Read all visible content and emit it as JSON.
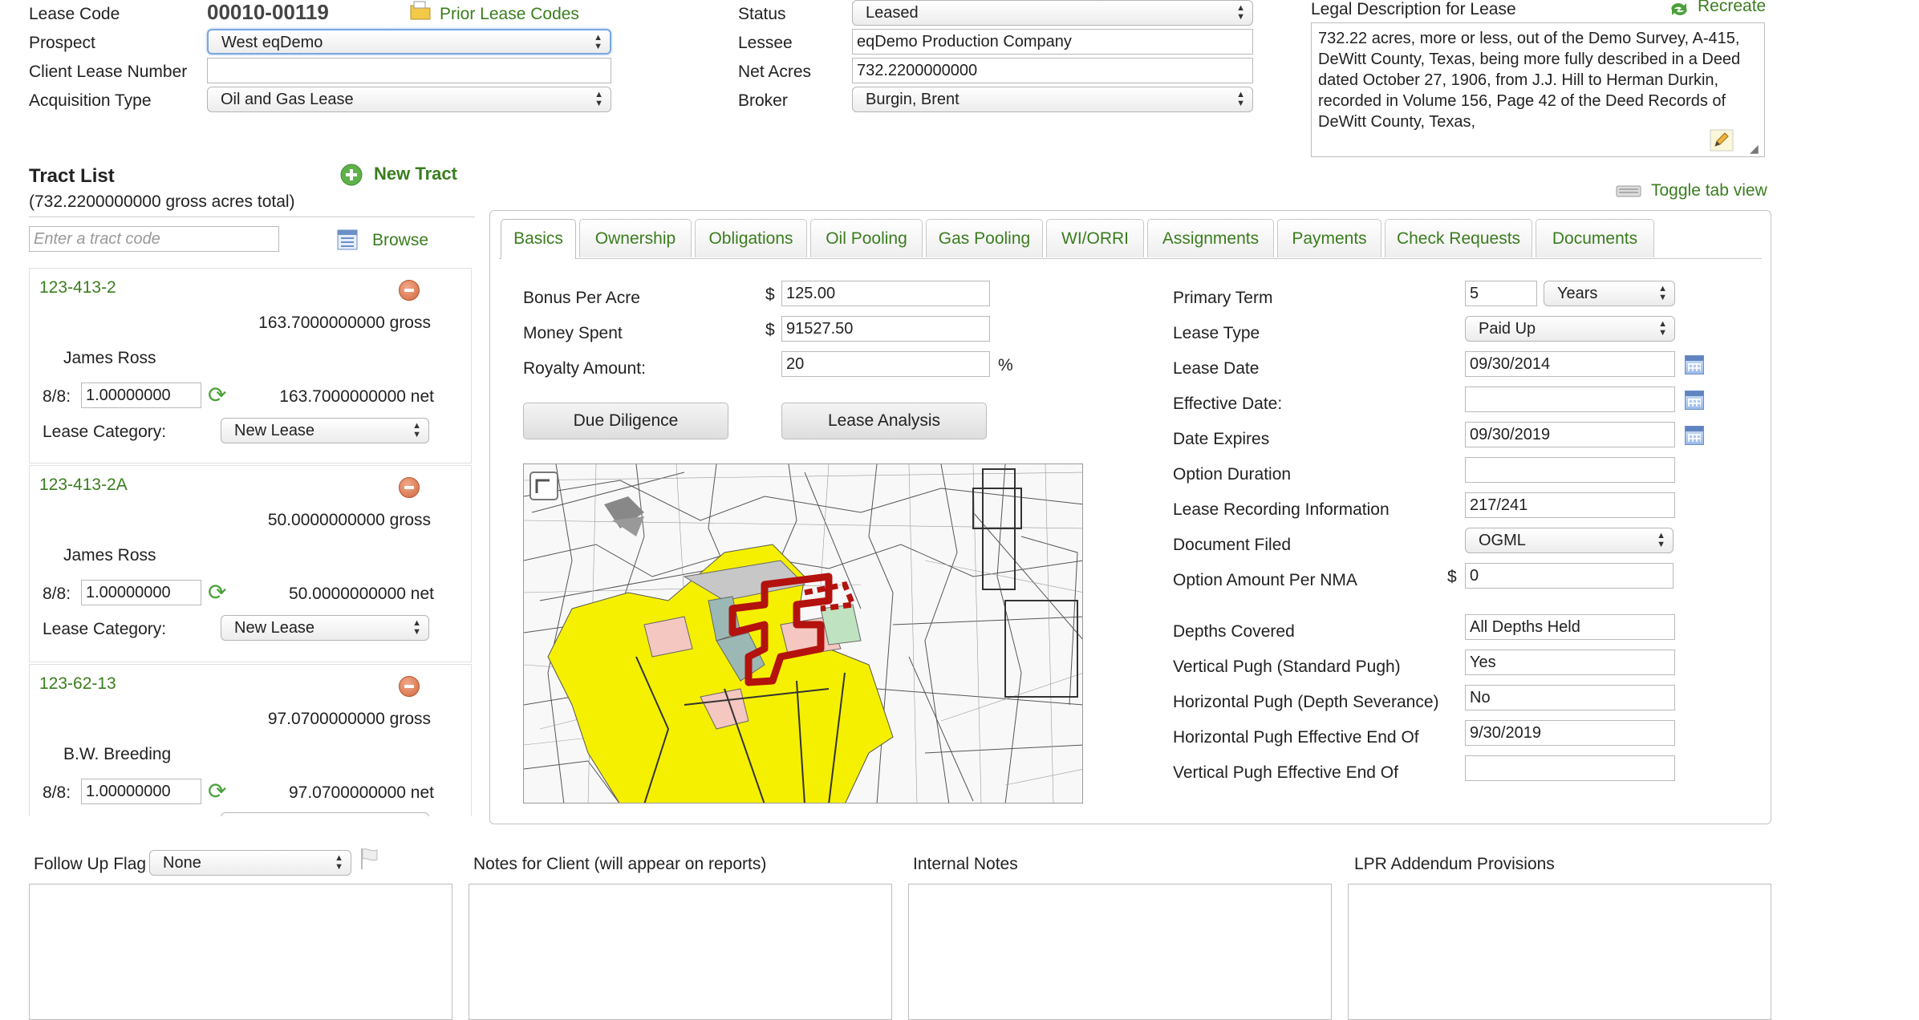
{
  "header": {
    "lease_code_label": "Lease Code",
    "lease_code_value": "00010-00119",
    "prior_lease_codes": "Prior Lease Codes",
    "prospect_label": "Prospect",
    "prospect_value": "West eqDemo",
    "client_lease_number_label": "Client Lease Number",
    "client_lease_number_value": "",
    "acquisition_type_label": "Acquisition Type",
    "acquisition_type_value": "Oil and Gas Lease",
    "status_label": "Status",
    "status_value": "Leased",
    "lessee_label": "Lessee",
    "lessee_value": "eqDemo Production Company",
    "net_acres_label": "Net Acres",
    "net_acres_value": "732.2200000000",
    "broker_label": "Broker",
    "broker_value": "Burgin, Brent",
    "legal_description_label": "Legal Description for Lease",
    "recreate_label": "Recreate",
    "legal_description_text": "732.22 acres, more or less, out of the Demo Survey, A-415, DeWitt County, Texas, being more fully described in a Deed dated October 27, 1906, from J.J. Hill to Herman Durkin, recorded in Volume 156, Page 42 of the Deed Records of DeWitt County, Texas,"
  },
  "tract_list": {
    "title": "Tract List",
    "subtitle": "(732.2200000000 gross acres total)",
    "new_tract_label": "New Tract",
    "search_placeholder": "Enter a tract code",
    "browse_label": "Browse",
    "eight_label": "8/8:",
    "category_label": "Lease Category:",
    "tracts": [
      {
        "code": "123-413-2",
        "gross": "163.7000000000 gross",
        "owner": "James Ross",
        "eight": "1.00000000",
        "net": "163.7000000000 net",
        "category": "New Lease"
      },
      {
        "code": "123-413-2A",
        "gross": "50.0000000000 gross",
        "owner": "James Ross",
        "eight": "1.00000000",
        "net": "50.0000000000 net",
        "category": "New Lease"
      },
      {
        "code": "123-62-13",
        "gross": "97.0700000000 gross",
        "owner": "B.W. Breeding",
        "eight": "1.00000000",
        "net": "97.0700000000 net",
        "category": ""
      }
    ]
  },
  "toggle_tab_view": "Toggle tab view",
  "tabs": [
    "Basics",
    "Ownership",
    "Obligations",
    "Oil Pooling",
    "Gas Pooling",
    "WI/ORRI",
    "Assignments",
    "Payments",
    "Check Requests",
    "Documents"
  ],
  "basics": {
    "bonus_per_acre_label": "Bonus Per Acre",
    "bonus_per_acre_value": "125.00",
    "money_spent_label": "Money Spent",
    "money_spent_value": "91527.50",
    "royalty_amount_label": "Royalty Amount:",
    "royalty_amount_value": "20",
    "dollar": "$",
    "percent": "%",
    "due_diligence": "Due Diligence",
    "lease_analysis": "Lease Analysis",
    "primary_term_label": "Primary Term",
    "primary_term_value": "5",
    "primary_term_unit": "Years",
    "lease_type_label": "Lease Type",
    "lease_type_value": "Paid Up",
    "lease_date_label": "Lease Date",
    "lease_date_value": "09/30/2014",
    "effective_date_label": "Effective Date:",
    "effective_date_value": "",
    "date_expires_label": "Date Expires",
    "date_expires_value": "09/30/2019",
    "option_duration_label": "Option Duration",
    "option_duration_value": "",
    "recording_info_label": "Lease Recording Information",
    "recording_info_value": "217/241",
    "document_filed_label": "Document Filed",
    "document_filed_value": "OGML",
    "option_amount_label": "Option Amount Per NMA",
    "option_amount_value": "0",
    "depths_covered_label": "Depths Covered",
    "depths_covered_value": "All Depths Held",
    "vertical_pugh_label": "Vertical Pugh (Standard Pugh)",
    "vertical_pugh_value": "Yes",
    "horizontal_pugh_label": "Horizontal Pugh (Depth Severance)",
    "horizontal_pugh_value": "No",
    "horizontal_pugh_end_label": "Horizontal Pugh Effective End Of",
    "horizontal_pugh_end_value": "9/30/2019",
    "vertical_pugh_end_label": "Vertical Pugh Effective End Of",
    "vertical_pugh_end_value": ""
  },
  "bottom": {
    "follow_up_flag_label": "Follow Up Flag",
    "follow_up_flag_value": "None",
    "notes_client_label": "Notes for Client (will appear on reports)",
    "internal_notes_label": "Internal Notes",
    "lpr_label": "LPR Addendum Provisions"
  },
  "colors": {
    "link_green": "#3a7d1e",
    "map_yellow": "#f5f000",
    "map_red": "#b3120e"
  }
}
